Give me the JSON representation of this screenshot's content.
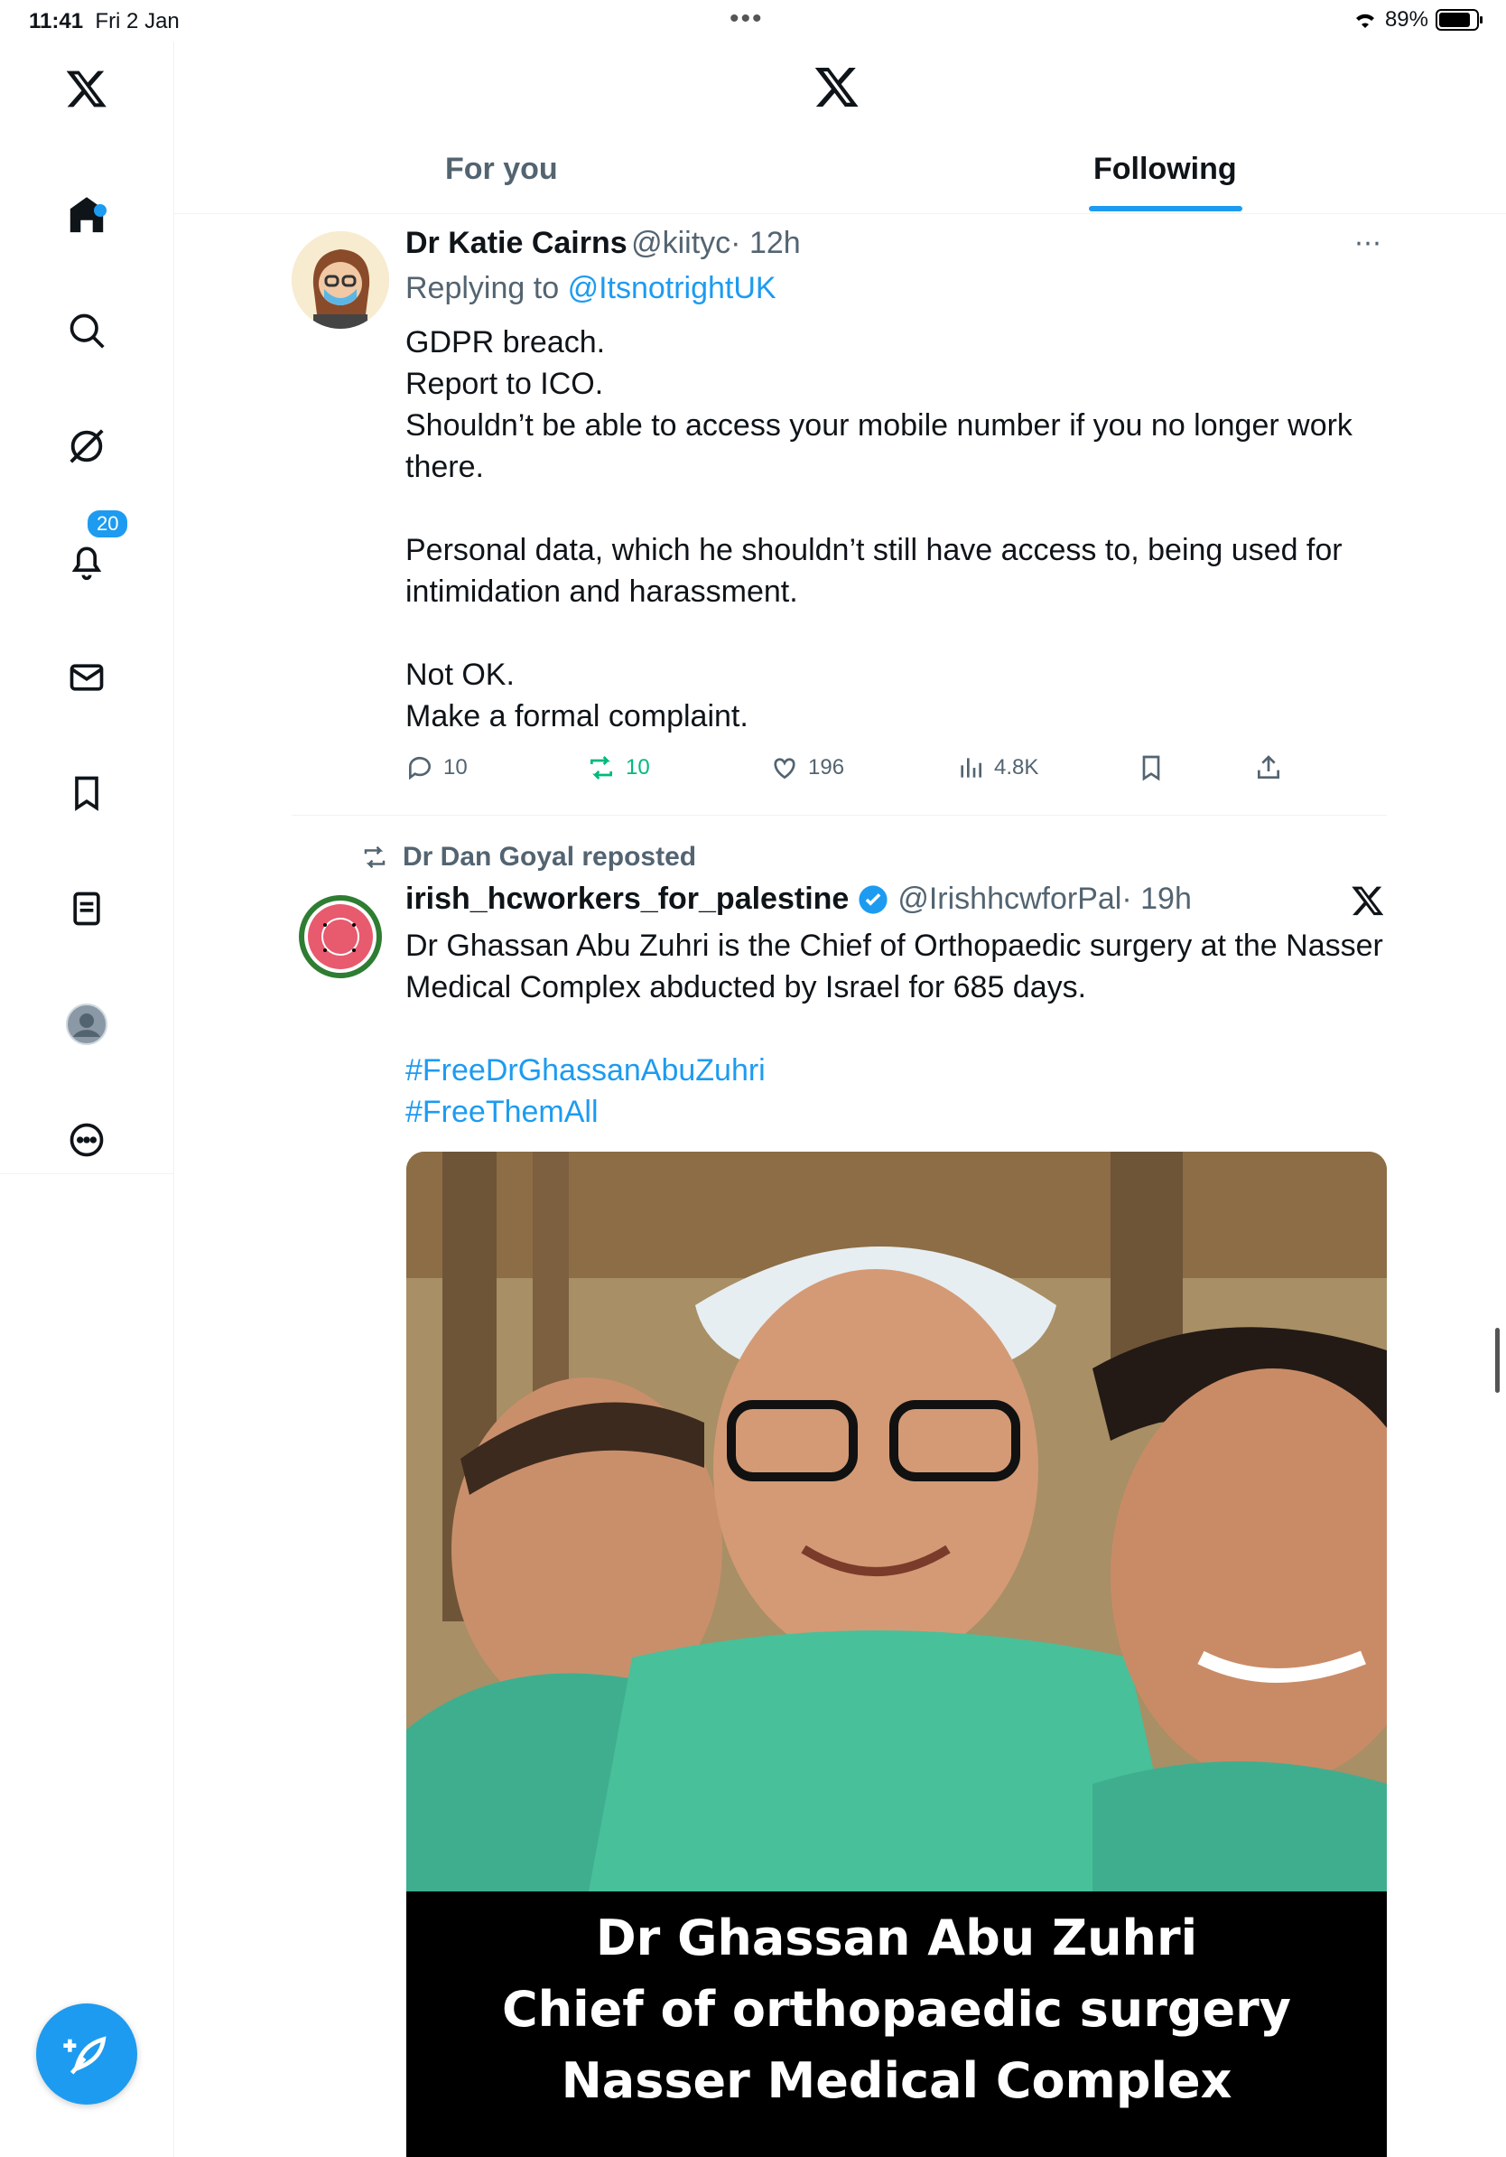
{
  "status_bar": {
    "time": "11:41",
    "date": "Fri 2 Jan",
    "battery": "89%",
    "icons": [
      "wifi-icon",
      "battery-icon"
    ]
  },
  "sidebar": {
    "items": [
      {
        "name": "x-logo"
      },
      {
        "name": "home"
      },
      {
        "name": "search"
      },
      {
        "name": "grok"
      },
      {
        "name": "notifications",
        "badge": "20"
      },
      {
        "name": "messages"
      },
      {
        "name": "bookmarks"
      },
      {
        "name": "lists"
      },
      {
        "name": "profile"
      },
      {
        "name": "more"
      }
    ],
    "compose_icon": "compose-feather-icon"
  },
  "header": {
    "tabs": [
      {
        "label": "For you",
        "active": false
      },
      {
        "label": "Following",
        "active": true
      }
    ]
  },
  "colors": {
    "accent": "#1d9bf0",
    "retweet": "#00ba7c",
    "muted": "#536471"
  },
  "posts": [
    {
      "display_name": "Dr Katie Cairns",
      "handle": "@kiityc",
      "time": "· 12h",
      "replying_prefix": "Replying to",
      "replying_to": "@ItsnotrightUK",
      "text": "GDPR breach.\nReport to ICO.\nShouldn’t be able to access your mobile number if you no longer work there.\n\nPersonal data, which he shouldn’t still have access to,  being used for intimidation and harassment.\n\nNot OK.\nMake a formal complaint.",
      "replies": "10",
      "reposts": "10",
      "likes": "196",
      "views": "4.8K"
    },
    {
      "repost_label": "Dr Dan Goyal reposted",
      "display_name": "irish_hcworkers_for_palestine",
      "handle": "@IrishhcwforPal",
      "time": "· 19h",
      "text": "Dr Ghassan Abu Zuhri is the Chief of Orthopaedic surgery at the Nasser Medical Complex abducted by Israel for 685 days.",
      "hashtags": [
        "#FreeDrGhassanAbuZuhri",
        "#FreeThemAll"
      ],
      "image_caption": [
        "Dr Ghassan Abu Zuhri",
        "Chief of orthopaedic surgery",
        "Nasser Medical Complex"
      ]
    }
  ]
}
